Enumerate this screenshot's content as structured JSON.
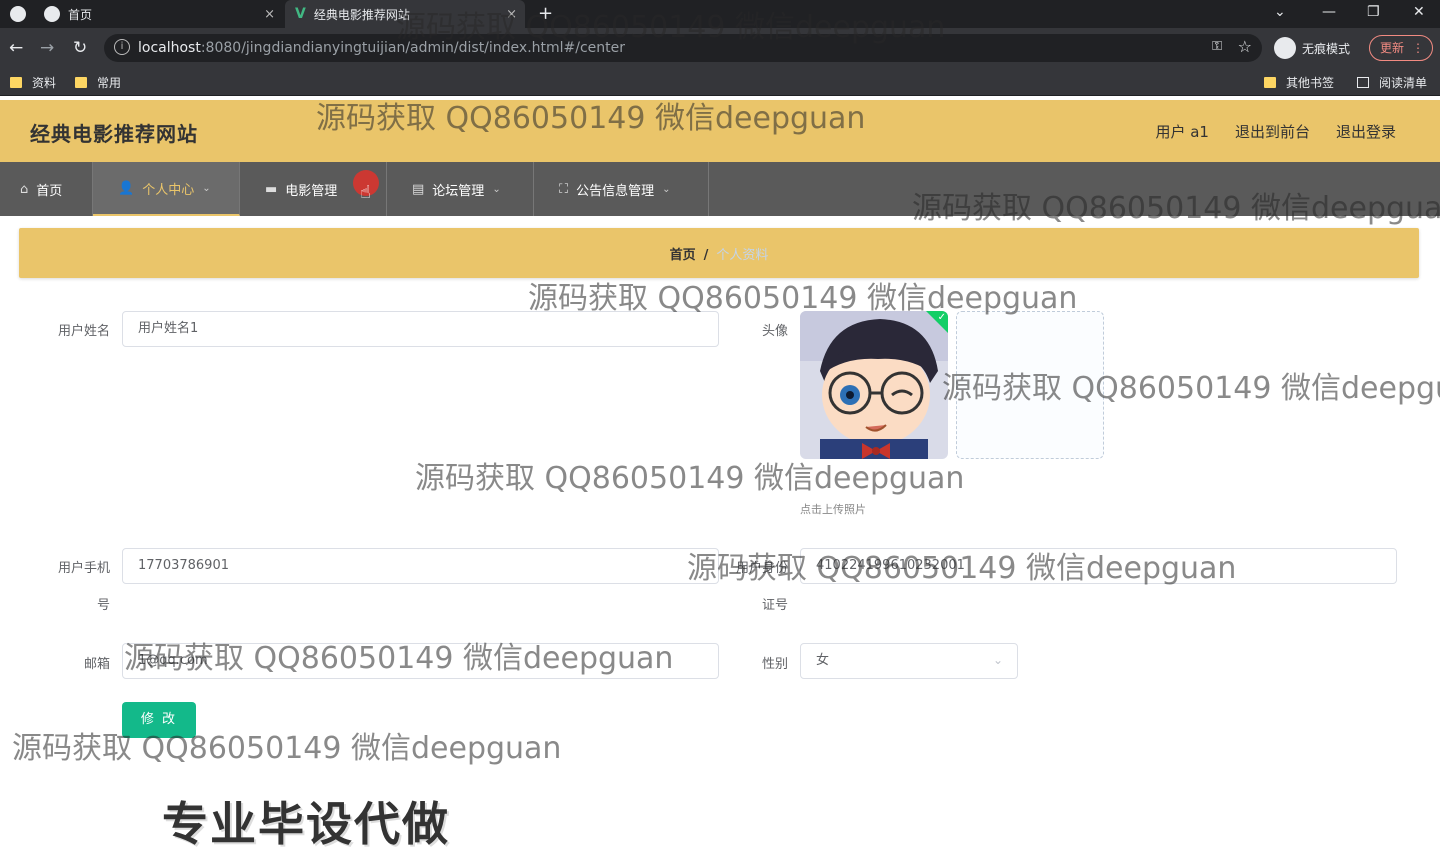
{
  "browser": {
    "tabs": [
      {
        "label": "首页",
        "close": "×"
      },
      {
        "label": "经典电影推荐网站",
        "close": "×"
      }
    ],
    "new_tab": "+",
    "url_host": "localhost",
    "url_rest": ":8080/jingdiandianyingtuijian/admin/dist/index.html#/center",
    "incognito_label": "无痕模式",
    "update_label": "更新",
    "bookmarks": [
      {
        "label": "资料"
      },
      {
        "label": "常用"
      },
      {
        "label": "其他书签"
      },
      {
        "label": "阅读清单"
      }
    ]
  },
  "header": {
    "site_title": "经典电影推荐网站",
    "user_label": "用户 a1",
    "back_to_front": "退出到前台",
    "logout": "退出登录"
  },
  "nav": {
    "items": [
      {
        "label": "首页",
        "icon": "home-icon"
      },
      {
        "label": "个人中心",
        "icon": "user-icon",
        "active": true
      },
      {
        "label": "电影管理",
        "icon": "film-icon"
      },
      {
        "label": "论坛管理",
        "icon": "document-icon"
      },
      {
        "label": "公告信息管理",
        "icon": "fullscreen-icon"
      }
    ]
  },
  "breadcrumb": {
    "home": "首页",
    "separator": "/",
    "current": "个人资料"
  },
  "form": {
    "username_label": "用户姓名",
    "username_value": "用户姓名1",
    "avatar_label": "头像",
    "upload_tip": "点击上传照片",
    "phone_label_1": "用户手机",
    "phone_label_2": "号",
    "phone_value": "17703786901",
    "idcard_label_1": "用户身份",
    "idcard_label_2": "证号",
    "idcard_value": "410224199610232001",
    "email_label": "邮箱",
    "email_value": "1@qq.com",
    "gender_label": "性别",
    "gender_value": "女",
    "submit_label": "修 改"
  },
  "watermarks": [
    "源码获取 QQ86050149 微信deepguan",
    "源码获取 QQ86050149 微信deepguan",
    "源码获取 QQ86050149 微信deepguan",
    "源码获取 QQ86050149 微信deepguan",
    "源码获取 QQ86050149 微信deepgu",
    "源码获取 QQ86050149 微信deepguan",
    "源码获取 QQ86050149 微信deepguan",
    "源码获取 QQ86050149 微信deepguan",
    "源码获取 QQ86050149 微信deepguan"
  ],
  "footer_caption": "专业毕设代做",
  "colors": {
    "header_bg": "#eac56a",
    "nav_bg": "#5a5a5a",
    "accent": "#eac56a",
    "button": "#13b98a"
  }
}
